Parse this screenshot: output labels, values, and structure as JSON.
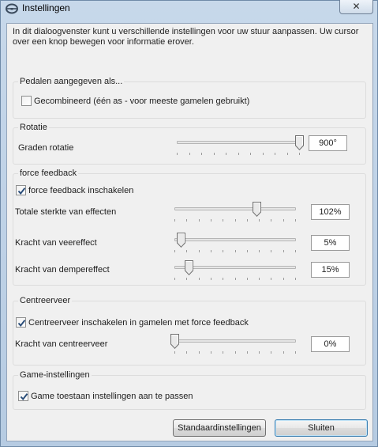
{
  "window": {
    "title": "Instellingen",
    "close_glyph": "✕",
    "icon": "steering-wheel-icon"
  },
  "intro": "In dit dialoogvenster kunt u verschillende instellingen voor uw stuur aanpassen.  Uw cursor over een knop bewegen voor informatie erover.",
  "pedals": {
    "group_label": "Pedalen aangegeven als...",
    "combined_label": "Gecombineerd (één as - voor meeste gamelen gebruikt)",
    "combined_checked": false
  },
  "rotation": {
    "group_label": "Rotatie",
    "degrees_label": "Graden rotatie",
    "degrees_value": "900°",
    "slider_fraction": 1.0
  },
  "force_feedback": {
    "group_label": "force feedback",
    "enable_label": "force feedback inschakelen",
    "enable_checked": true,
    "total_label": "Totale sterkte van effecten",
    "total_value": "102%",
    "total_fraction": 0.68,
    "spring_label": "Kracht van veereffect",
    "spring_value": "5%",
    "spring_fraction": 0.05,
    "damper_label": "Kracht van dempereffect",
    "damper_value": "15%",
    "damper_fraction": 0.12
  },
  "centering": {
    "group_label": "Centreerveer",
    "enable_label": "Centreerveer inschakelen in gamelen met force feedback",
    "enable_checked": true,
    "strength_label": "Kracht van centreerveer",
    "strength_value": "0%",
    "strength_fraction": 0.0
  },
  "game_settings": {
    "group_label": "Game-instellingen",
    "allow_label": "Game toestaan instellingen aan te passen",
    "allow_checked": true
  },
  "buttons": {
    "defaults_label": "Standaardinstellingen",
    "close_label": "Sluiten"
  }
}
